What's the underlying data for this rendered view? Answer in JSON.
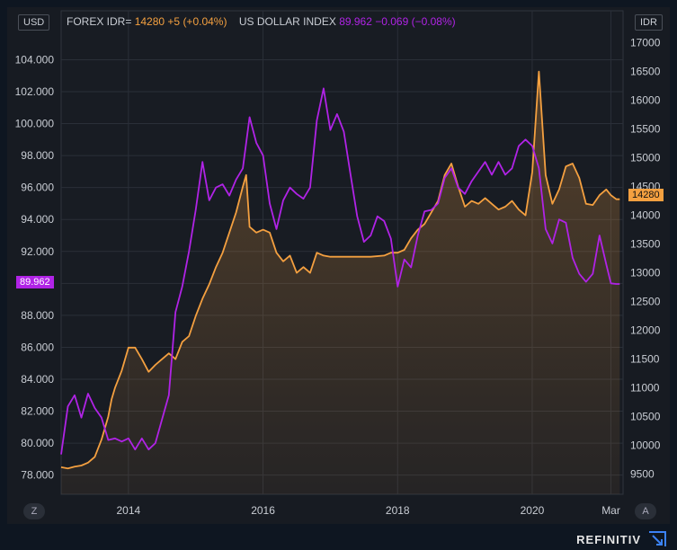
{
  "header": {
    "left_unit": "USD",
    "right_unit": "IDR",
    "series1_name": "FOREX IDR=",
    "series1_value": "14280",
    "series1_change": "+5 (+0.04%)",
    "series2_name": "US DOLLAR INDEX",
    "series2_value": "89.962",
    "series2_change": "−0.069 (−0.08%)"
  },
  "controls": {
    "zoom_label": "Z",
    "auto_label": "A"
  },
  "price_tags": {
    "left": "89.962",
    "right": "14280"
  },
  "brand": "REFINITIV",
  "colors": {
    "idr": "#f4a040",
    "usd": "#b023e6",
    "grid": "#2a2f38",
    "bg": "#171b22"
  },
  "chart_data": {
    "type": "line",
    "left_axis": {
      "unit": "USD",
      "ticks": [
        "78.000",
        "80.000",
        "82.000",
        "84.000",
        "86.000",
        "88.000",
        "90.000",
        "92.000",
        "94.000",
        "96.000",
        "98.000",
        "100.000",
        "102.000",
        "104.000"
      ],
      "range": [
        76.8,
        105.6
      ]
    },
    "right_axis": {
      "unit": "IDR",
      "ticks": [
        "9500",
        "10000",
        "10500",
        "11000",
        "11500",
        "12000",
        "12500",
        "13000",
        "13500",
        "14000",
        "14500",
        "15000",
        "15500",
        "16000",
        "16500",
        "17000"
      ],
      "range": [
        9150,
        17150
      ]
    },
    "x_ticks": [
      "2014",
      "2016",
      "2018",
      "2020",
      "Mar"
    ],
    "x_tick_pos": [
      2014.0,
      2016.0,
      2018.0,
      2020.0,
      2021.17
    ],
    "x_range": [
      2013.0,
      2021.35
    ],
    "grid": true,
    "series": [
      {
        "name": "FOREX IDR=",
        "axis": "right",
        "color": "#f4a040",
        "fill": true,
        "x": [
          2013.0,
          2013.1,
          2013.2,
          2013.3,
          2013.4,
          2013.5,
          2013.6,
          2013.7,
          2013.75,
          2013.8,
          2013.9,
          2014.0,
          2014.1,
          2014.2,
          2014.3,
          2014.4,
          2014.5,
          2014.6,
          2014.7,
          2014.8,
          2014.9,
          2015.0,
          2015.1,
          2015.2,
          2015.3,
          2015.4,
          2015.5,
          2015.6,
          2015.7,
          2015.75,
          2015.8,
          2015.9,
          2016.0,
          2016.1,
          2016.2,
          2016.3,
          2016.4,
          2016.5,
          2016.6,
          2016.7,
          2016.8,
          2016.9,
          2017.0,
          2017.2,
          2017.4,
          2017.6,
          2017.8,
          2017.9,
          2018.0,
          2018.1,
          2018.2,
          2018.3,
          2018.4,
          2018.5,
          2018.6,
          2018.7,
          2018.8,
          2018.9,
          2019.0,
          2019.1,
          2019.2,
          2019.3,
          2019.4,
          2019.5,
          2019.6,
          2019.7,
          2019.8,
          2019.9,
          2020.0,
          2020.1,
          2020.2,
          2020.3,
          2020.4,
          2020.5,
          2020.6,
          2020.7,
          2020.8,
          2020.9,
          2021.0,
          2021.1,
          2021.17,
          2021.25,
          2021.3
        ],
        "y": [
          9620,
          9600,
          9630,
          9650,
          9700,
          9800,
          10100,
          10500,
          10800,
          11000,
          11300,
          11700,
          11700,
          11500,
          11280,
          11400,
          11500,
          11600,
          11500,
          11800,
          11900,
          12250,
          12550,
          12800,
          13100,
          13350,
          13700,
          14050,
          14500,
          14700,
          13800,
          13700,
          13750,
          13700,
          13350,
          13200,
          13300,
          13000,
          13100,
          13000,
          13350,
          13300,
          13280,
          13280,
          13280,
          13280,
          13300,
          13350,
          13350,
          13400,
          13600,
          13750,
          13850,
          14050,
          14250,
          14700,
          14900,
          14500,
          14150,
          14250,
          14200,
          14300,
          14200,
          14100,
          14150,
          14250,
          14100,
          14000,
          14750,
          16500,
          14700,
          14200,
          14450,
          14850,
          14900,
          14650,
          14200,
          14180,
          14350,
          14450,
          14350,
          14280,
          14280
        ]
      },
      {
        "name": "US DOLLAR INDEX",
        "axis": "left",
        "color": "#b023e6",
        "fill": false,
        "x": [
          2013.0,
          2013.1,
          2013.2,
          2013.3,
          2013.4,
          2013.5,
          2013.6,
          2013.7,
          2013.8,
          2013.9,
          2014.0,
          2014.1,
          2014.2,
          2014.3,
          2014.4,
          2014.5,
          2014.6,
          2014.7,
          2014.8,
          2014.9,
          2015.0,
          2015.1,
          2015.2,
          2015.3,
          2015.4,
          2015.5,
          2015.6,
          2015.7,
          2015.8,
          2015.9,
          2016.0,
          2016.1,
          2016.2,
          2016.3,
          2016.4,
          2016.5,
          2016.6,
          2016.7,
          2016.8,
          2016.9,
          2017.0,
          2017.1,
          2017.2,
          2017.3,
          2017.4,
          2017.5,
          2017.6,
          2017.7,
          2017.8,
          2017.9,
          2018.0,
          2018.1,
          2018.2,
          2018.3,
          2018.4,
          2018.5,
          2018.6,
          2018.7,
          2018.8,
          2018.9,
          2019.0,
          2019.1,
          2019.2,
          2019.3,
          2019.4,
          2019.5,
          2019.6,
          2019.7,
          2019.8,
          2019.9,
          2020.0,
          2020.1,
          2020.2,
          2020.3,
          2020.4,
          2020.5,
          2020.6,
          2020.7,
          2020.8,
          2020.9,
          2021.0,
          2021.1,
          2021.17,
          2021.25,
          2021.3
        ],
        "y": [
          79.3,
          82.3,
          83.0,
          81.6,
          83.1,
          82.2,
          81.6,
          80.2,
          80.3,
          80.1,
          80.3,
          79.6,
          80.3,
          79.6,
          80.0,
          81.5,
          83.0,
          88.2,
          89.8,
          92.0,
          94.6,
          97.6,
          95.2,
          96.0,
          96.2,
          95.5,
          96.5,
          97.2,
          100.4,
          98.8,
          98.0,
          95.0,
          93.4,
          95.2,
          96.0,
          95.6,
          95.3,
          96.0,
          100.2,
          102.2,
          99.6,
          100.6,
          99.5,
          96.8,
          94.2,
          92.6,
          93.0,
          94.2,
          93.9,
          92.8,
          89.8,
          91.5,
          91.0,
          93.0,
          94.5,
          94.6,
          95.0,
          96.6,
          97.2,
          96.0,
          95.6,
          96.4,
          97.0,
          97.6,
          96.8,
          97.6,
          96.8,
          97.2,
          98.6,
          99.0,
          98.6,
          97.2,
          93.4,
          92.5,
          94.0,
          93.8,
          91.6,
          90.6,
          90.1,
          90.6,
          93.0,
          91.2,
          90.0,
          89.96,
          89.96
        ]
      }
    ]
  }
}
